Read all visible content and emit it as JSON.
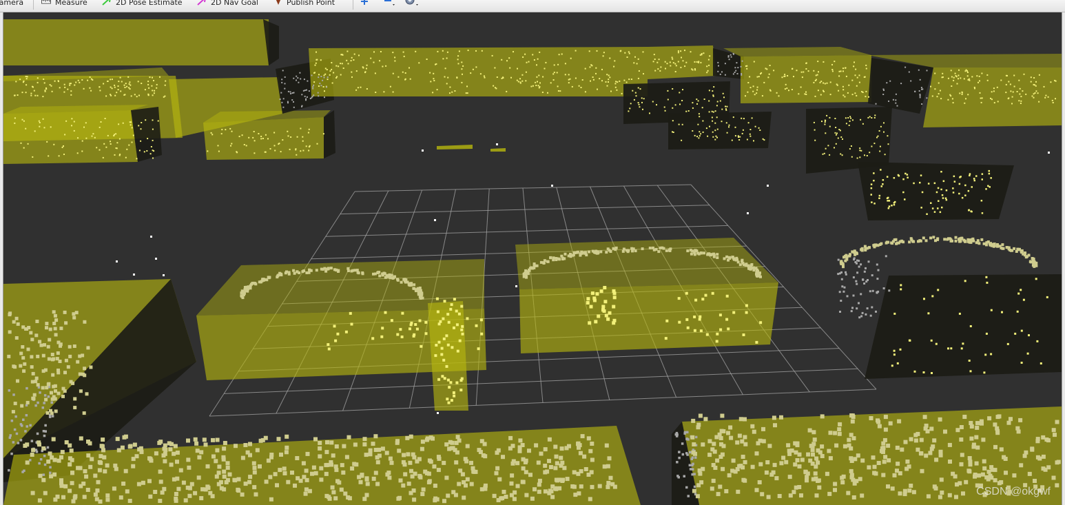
{
  "toolbar": {
    "camera_label": "Camera",
    "measure_label": "Measure",
    "pose_estimate_label": "2D Pose Estimate",
    "nav_goal_label": "2D Nav Goal",
    "publish_point_label": "Publish Point"
  },
  "icons": {
    "camera": "camera-icon",
    "measure": "ruler-icon",
    "pose_estimate": "green-arrow-icon",
    "nav_goal": "magenta-arrow-icon",
    "publish_point": "map-pin-icon",
    "add_tool": "plus-icon",
    "remove_tool": "minus-icon",
    "camera_type": "eye-icon"
  },
  "colors": {
    "background": "#303030",
    "box_fill": "#b8b80e",
    "points_yellow": "#f2f07a",
    "points_tan": "#cfcc8e",
    "points_gray": "#a8a8a8",
    "grid": "#a6a6a6",
    "pose_arrow": "#3bc93b",
    "nav_arrow": "#d23ad2",
    "pin": "#8b3a1a"
  },
  "watermark": "CSDN @okgwf"
}
